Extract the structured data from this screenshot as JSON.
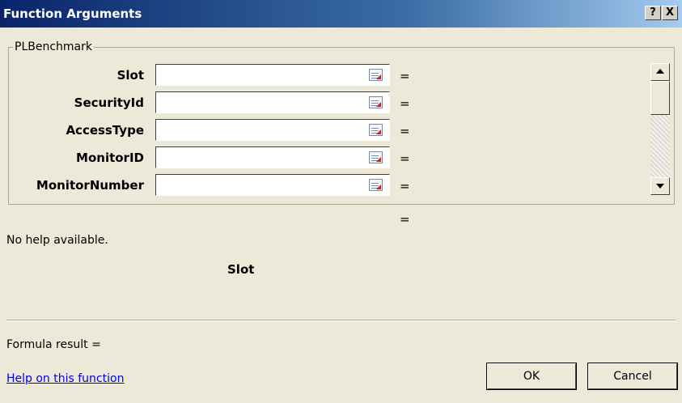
{
  "window": {
    "title": "Function Arguments",
    "help_glyph": "?",
    "close_glyph": "X"
  },
  "function_group": {
    "name": "PLBenchmark"
  },
  "arguments": [
    {
      "label": "Slot",
      "value": "",
      "equals": "="
    },
    {
      "label": "SecurityId",
      "value": "",
      "equals": "="
    },
    {
      "label": "AccessType",
      "value": "",
      "equals": "="
    },
    {
      "label": "MonitorID",
      "value": "",
      "equals": "="
    },
    {
      "label": "MonitorNumber",
      "value": "",
      "equals": "="
    }
  ],
  "result_equals": "=",
  "description": "No help available.",
  "current_arg": "Slot",
  "formula_result": "Formula result =",
  "help_link": "Help on this function",
  "buttons": {
    "ok": "OK",
    "cancel": "Cancel"
  }
}
